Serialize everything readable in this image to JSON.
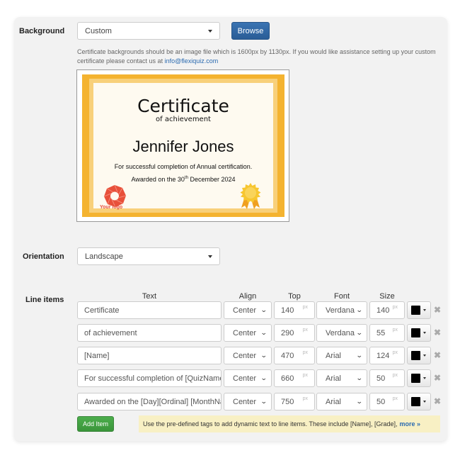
{
  "background": {
    "label": "Background",
    "select_value": "Custom",
    "browse_label": "Browse",
    "help_text": "Certificate backgrounds should be an image file which is 1600px by 1130px. If you would like assistance setting up your custom certificate please contact us at",
    "help_email": "info@flexiquiz.com"
  },
  "preview": {
    "title": "Certificate",
    "subtitle": "of achievement",
    "name": "Jennifer Jones",
    "line1": "For successful completion of Annual certification.",
    "line2_prefix": "Awarded on the 30",
    "line2_sup": "th",
    "line2_suffix": " December 2024",
    "logo_text": "Your logo",
    "colors": {
      "border": "#f4b330",
      "band": "#f8d07a",
      "paper": "#fefaf0",
      "logo": "#e8503a",
      "seal": "#f5c021"
    }
  },
  "orientation": {
    "label": "Orientation",
    "select_value": "Landscape"
  },
  "line_items": {
    "label": "Line items",
    "headers": {
      "text": "Text",
      "align": "Align",
      "top": "Top",
      "font": "Font",
      "size": "Size"
    },
    "unit": "px",
    "rows": [
      {
        "text": "Certificate",
        "align": "Center",
        "top": "140",
        "font": "Verdana",
        "size": "140",
        "color": "#000000"
      },
      {
        "text": "of achievement",
        "align": "Center",
        "top": "290",
        "font": "Verdana",
        "size": "55",
        "color": "#000000"
      },
      {
        "text": "[Name]",
        "align": "Center",
        "top": "470",
        "font": "Arial",
        "size": "124",
        "color": "#000000"
      },
      {
        "text": "For successful completion of [QuizName",
        "align": "Center",
        "top": "660",
        "font": "Arial",
        "size": "50",
        "color": "#000000"
      },
      {
        "text": "Awarded on the [Day][Ordinal] [MonthNa",
        "align": "Center",
        "top": "750",
        "font": "Arial",
        "size": "50",
        "color": "#000000"
      }
    ],
    "add_label": "Add Item",
    "tip_text": "Use the pre-defined tags to add dynamic text to line items. These include [Name], [Grade],",
    "tip_link": "more »"
  }
}
